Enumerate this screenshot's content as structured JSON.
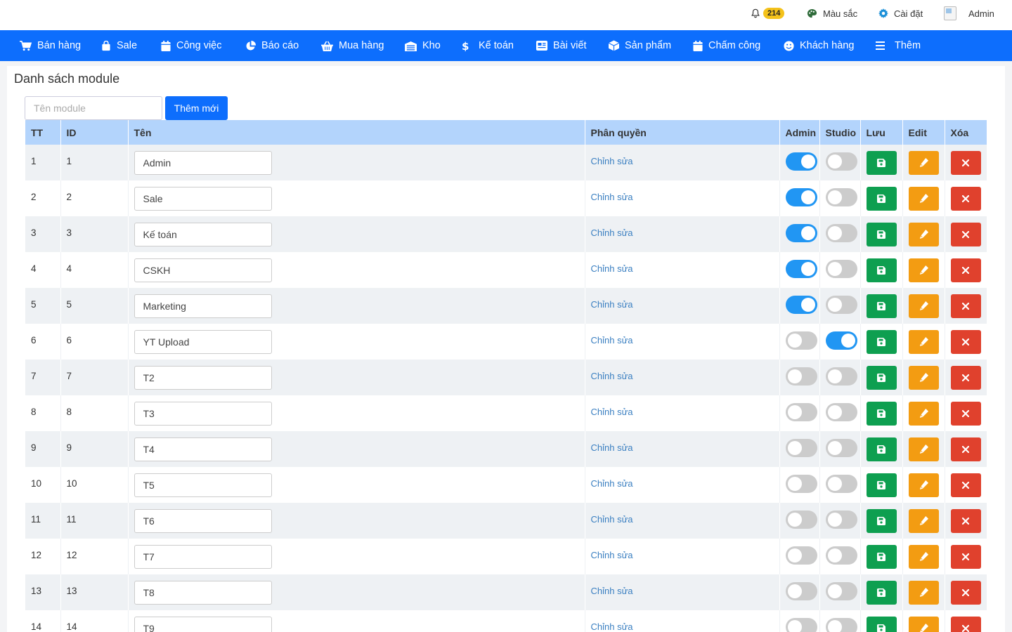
{
  "topbar": {
    "notification_count": "214",
    "color_label": "Màu sắc",
    "settings_label": "Cài đặt",
    "user_label": "Admin"
  },
  "nav": {
    "items": [
      {
        "label": "Bán hàng",
        "icon": "cart-icon"
      },
      {
        "label": "Sale",
        "icon": "bag-icon"
      },
      {
        "label": "Công việc",
        "icon": "calendar-icon"
      },
      {
        "label": "Báo cáo",
        "icon": "pie-chart-icon"
      },
      {
        "label": "Mua hàng",
        "icon": "basket-icon"
      },
      {
        "label": "Kho",
        "icon": "warehouse-icon"
      },
      {
        "label": "Kế toán",
        "icon": "dollar-icon"
      },
      {
        "label": "Bài viết",
        "icon": "article-icon"
      },
      {
        "label": "Sản phẩm",
        "icon": "box-icon"
      },
      {
        "label": "Chấm công",
        "icon": "calendar-icon"
      },
      {
        "label": "Khách hàng",
        "icon": "smile-icon"
      },
      {
        "label": "Thêm",
        "icon": "menu-icon"
      }
    ]
  },
  "page": {
    "title": "Danh sách module",
    "search_placeholder": "Tên module",
    "add_button": "Thêm mới"
  },
  "table": {
    "headers": {
      "tt": "TT",
      "id": "ID",
      "name": "Tên",
      "permission": "Phân quyền",
      "admin": "Admin",
      "studio": "Studio",
      "save": "Lưu",
      "edit": "Edit",
      "delete": "Xóa"
    },
    "rows": [
      {
        "tt": "1",
        "id": "1",
        "name": "Admin",
        "permission": "Chỉnh sửa",
        "admin": true,
        "studio": false
      },
      {
        "tt": "2",
        "id": "2",
        "name": "Sale",
        "permission": "Chỉnh sửa",
        "admin": true,
        "studio": false
      },
      {
        "tt": "3",
        "id": "3",
        "name": "Kế toán",
        "permission": "Chỉnh sửa",
        "admin": true,
        "studio": false
      },
      {
        "tt": "4",
        "id": "4",
        "name": "CSKH",
        "permission": "Chỉnh sửa",
        "admin": true,
        "studio": false
      },
      {
        "tt": "5",
        "id": "5",
        "name": "Marketing",
        "permission": "Chỉnh sửa",
        "admin": true,
        "studio": false
      },
      {
        "tt": "6",
        "id": "6",
        "name": "YT Upload",
        "permission": "Chỉnh sửa",
        "admin": false,
        "studio": true
      },
      {
        "tt": "7",
        "id": "7",
        "name": "T2",
        "permission": "Chỉnh sửa",
        "admin": false,
        "studio": false
      },
      {
        "tt": "8",
        "id": "8",
        "name": "T3",
        "permission": "Chỉnh sửa",
        "admin": false,
        "studio": false
      },
      {
        "tt": "9",
        "id": "9",
        "name": "T4",
        "permission": "Chỉnh sửa",
        "admin": false,
        "studio": false
      },
      {
        "tt": "10",
        "id": "10",
        "name": "T5",
        "permission": "Chỉnh sửa",
        "admin": false,
        "studio": false
      },
      {
        "tt": "11",
        "id": "11",
        "name": "T6",
        "permission": "Chỉnh sửa",
        "admin": false,
        "studio": false
      },
      {
        "tt": "12",
        "id": "12",
        "name": "T7",
        "permission": "Chỉnh sửa",
        "admin": false,
        "studio": false
      },
      {
        "tt": "13",
        "id": "13",
        "name": "T8",
        "permission": "Chỉnh sửa",
        "admin": false,
        "studio": false
      },
      {
        "tt": "14",
        "id": "14",
        "name": "T9",
        "permission": "Chỉnh sửa",
        "admin": false,
        "studio": false
      }
    ]
  },
  "colors": {
    "nav_bg": "#0d6efd",
    "header_bg": "#b3d4fc",
    "toggle_on": "#2196f3",
    "save": "#0e9f50",
    "edit": "#f39c12",
    "delete": "#e0412d",
    "badge": "#f4c21b"
  }
}
